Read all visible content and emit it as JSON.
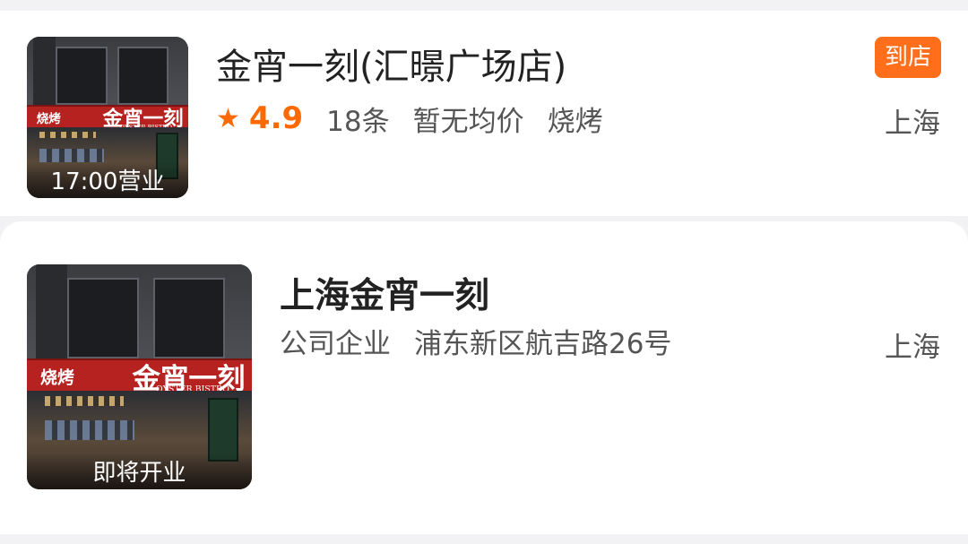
{
  "results": [
    {
      "name": "金宵一刻(汇暻广场店)",
      "thumb_label": "17:00营业",
      "rating": "4.9",
      "review_count": "18条",
      "avg_price": "暂无均价",
      "category": "烧烤",
      "badge": "到店",
      "city": "上海",
      "star_icon": "star-icon"
    },
    {
      "name": "上海金宵一刻",
      "thumb_label": "即将开业",
      "type": "公司企业",
      "address": "浦东新区航吉路26号",
      "city": "上海"
    }
  ],
  "signage": {
    "left": "烧烤",
    "right": "金宵一刻",
    "sub": "OYSTER BISTRO"
  },
  "colors": {
    "accent": "#ff6a00",
    "badge_bg": "#ff6e1a",
    "sign_red": "#b5221f"
  }
}
